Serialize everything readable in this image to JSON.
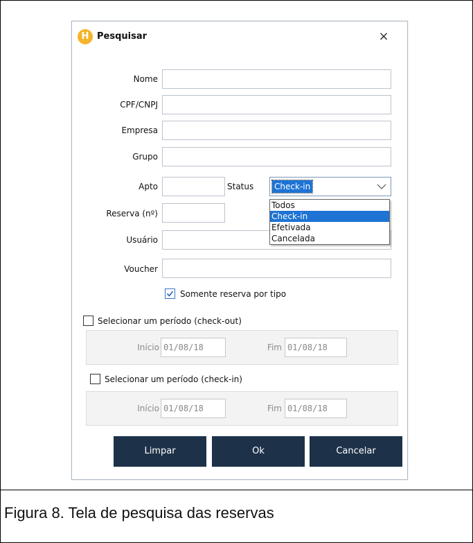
{
  "dialog": {
    "title": "Pesquisar",
    "app_icon_letter": "H",
    "close_symbol": "×"
  },
  "form": {
    "nome_label": "Nome",
    "nome_value": "",
    "cpf_label": "CPF/CNPJ",
    "cpf_value": "",
    "empresa_label": "Empresa",
    "empresa_value": "",
    "grupo_label": "Grupo",
    "grupo_value": "",
    "apto_label": "Apto",
    "apto_value": "",
    "status_label": "Status",
    "status_selected": "Check-in",
    "status_options": [
      "Todos",
      "Check-in",
      "Efetivada",
      "Cancelada"
    ],
    "reserva_label": "Reserva (nº)",
    "reserva_value": "",
    "usuario_label": "Usuário",
    "usuario_value": "",
    "voucher_label": "Voucher",
    "voucher_value": ""
  },
  "somente_reserva": {
    "label": "Somente reserva por tipo",
    "checked": true
  },
  "checkout_period": {
    "label": "Selecionar um período (check-out)",
    "checked": false,
    "inicio_label": "Início",
    "inicio_value": "01/08/18",
    "fim_label": "Fim",
    "fim_value": "01/08/18"
  },
  "checkin_period": {
    "label": "Selecionar um período (check-in)",
    "checked": false,
    "inicio_label": "Início",
    "inicio_value": "01/08/18",
    "fim_label": "Fim",
    "fim_value": "01/08/18"
  },
  "buttons": {
    "limpar": "Limpar",
    "ok": "Ok",
    "cancelar": "Cancelar"
  },
  "colors": {
    "button_bg": "#1d3249",
    "selection_blue": "#1e73d4",
    "icon_yellow": "#f4b52c"
  },
  "caption": "Figura 8. Tela de pesquisa das reservas"
}
